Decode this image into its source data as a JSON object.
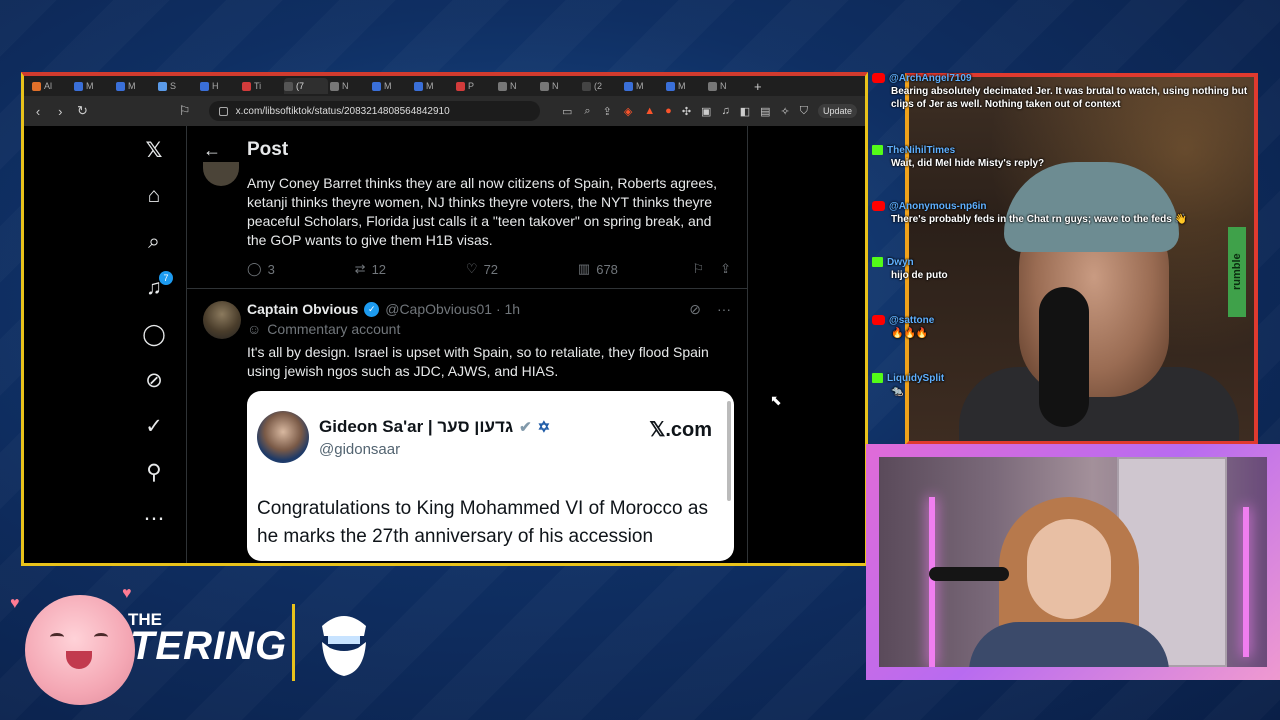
{
  "browser": {
    "url": "x.com/libsoftiktok/status/2083214808564842910",
    "update_label": "Update",
    "tabs": [
      "Al",
      "M",
      "M",
      "S",
      "H",
      "Ti",
      "(7",
      "N",
      "M",
      "M",
      "P",
      "N",
      "N",
      "(2",
      "M",
      "M",
      "N"
    ]
  },
  "x": {
    "header_title": "Post",
    "notifications_count": "7",
    "tweet1": {
      "text": "Amy Coney Barret thinks they are all now citizens of Spain, Roberts agrees, ketanji thinks theyre women, NJ thinks theyre voters, the NYT thinks theyre peaceful Scholars, Florida just calls it a \"teen takover\" on spring break, and the GOP wants to give them H1B visas.",
      "replies": "3",
      "reposts": "12",
      "likes": "72",
      "views": "678"
    },
    "tweet2": {
      "name": "Captain Obvious",
      "handle": "@CapObvious01 · 1h",
      "label": "Commentary account",
      "text": "It's all by design. Israel is upset with Spain, so to retaliate, they flood Spain using jewish ngos such as JDC, AJWS, and HIAS.",
      "embed": {
        "name": "Gideon Sa'ar | גדעון סער",
        "handle": "@gidonsaar",
        "brand": "𝕏.com",
        "text": "Congratulations to King Mohammed VI of Morocco as he marks the 27th anniversary of his accession"
      }
    }
  },
  "chat": [
    {
      "platform": "youtube",
      "user": "@ArchAngel7109",
      "text": "Bearing absolutely decimated Jer. It was brutal to watch, using nothing but clips of Jer as well. Nothing taken out of context"
    },
    {
      "platform": "kick",
      "user": "TheNihilTimes",
      "text": "Wait, did Mel hide Misty's reply?"
    },
    {
      "platform": "youtube",
      "user": "@Anonymous-np6in",
      "text": "There's probably feds in the Chat rn guys; wave to the feds 👋"
    },
    {
      "platform": "kick",
      "user": "Dwyn",
      "text": "hijo de puto"
    },
    {
      "platform": "youtube",
      "user": "@sattone",
      "text": "🔥🔥🔥"
    },
    {
      "platform": "kick",
      "user": "LiquidySplit",
      "text": "🐀"
    }
  ],
  "overlay": {
    "show_the": "THE",
    "show_name": "TERING",
    "rumble_label": "rumble"
  }
}
